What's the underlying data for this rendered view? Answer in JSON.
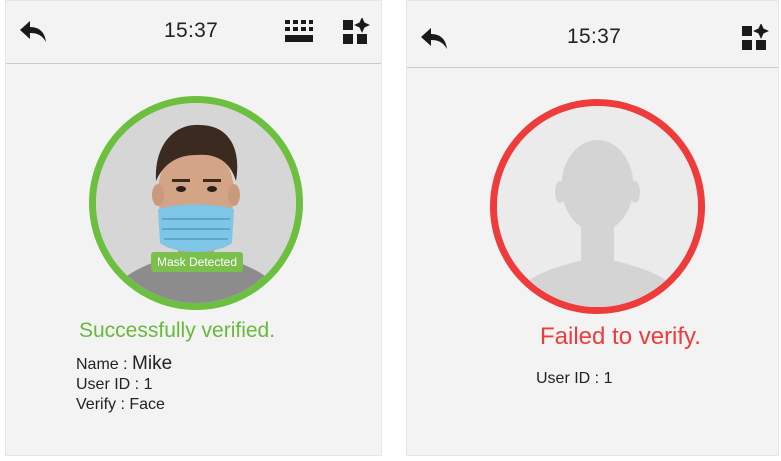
{
  "success_screen": {
    "time": "15:37",
    "icons": [
      "back-arrow-icon",
      "keyboard-icon",
      "apps-icon"
    ],
    "mask_label": "Mask Detected",
    "status": "Successfully verified.",
    "name_label": "Name :",
    "name_value": "Mike",
    "user_id_label": "User ID :",
    "user_id_value": "1",
    "verify_label": "Verify :",
    "verify_value": "Face",
    "ring_color": "#6cbf3f",
    "status_color": "#68b83d"
  },
  "failure_screen": {
    "time": "15:37",
    "icons": [
      "back-arrow-icon",
      "apps-icon"
    ],
    "status": "Failed to verify.",
    "user_id_label": "User ID :",
    "user_id_value": "1",
    "ring_color": "#ee3b3b",
    "status_color": "#ee3b3b"
  }
}
